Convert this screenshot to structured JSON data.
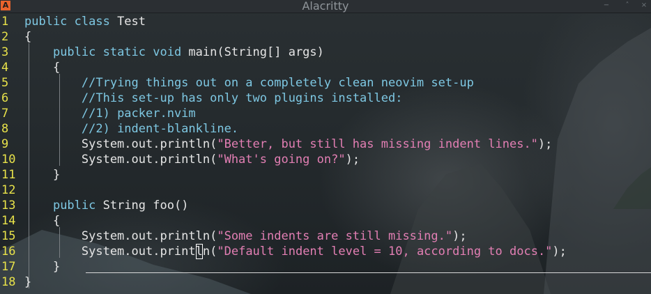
{
  "window": {
    "title": "Alacritty",
    "app_icon": "A",
    "controls": [
      "−",
      "˄",
      "×"
    ]
  },
  "colors": {
    "line_number": "#e8e24a",
    "keyword": "#7ec8e3",
    "comment": "#7ec8e3",
    "string": "#e37fb4",
    "text": "#e6e6e6"
  },
  "editor": {
    "lines": [
      {
        "n": "1",
        "parts": [
          [
            "kw",
            "public class "
          ],
          [
            "tx",
            "Test"
          ]
        ]
      },
      {
        "n": "2",
        "parts": [
          [
            "tx",
            "{"
          ]
        ]
      },
      {
        "n": "3",
        "parts": [
          [
            "tx",
            "    "
          ],
          [
            "kw",
            "public static void "
          ],
          [
            "tx",
            "main(String[] args)"
          ]
        ]
      },
      {
        "n": "4",
        "parts": [
          [
            "tx",
            "    {"
          ]
        ]
      },
      {
        "n": "5",
        "parts": [
          [
            "tx",
            "        "
          ],
          [
            "cm",
            "//Trying things out on a completely clean neovim set-up"
          ]
        ]
      },
      {
        "n": "6",
        "parts": [
          [
            "tx",
            "        "
          ],
          [
            "cm",
            "//This set-up has only two plugins installed:"
          ]
        ]
      },
      {
        "n": "7",
        "parts": [
          [
            "tx",
            "        "
          ],
          [
            "cm",
            "//1) packer.nvim"
          ]
        ]
      },
      {
        "n": "8",
        "parts": [
          [
            "tx",
            "        "
          ],
          [
            "cm",
            "//2) indent-blankline."
          ]
        ]
      },
      {
        "n": "9",
        "parts": [
          [
            "tx",
            "        System.out.println("
          ],
          [
            "st",
            "\"Better, but still has missing indent lines.\""
          ],
          [
            "tx",
            ");"
          ]
        ]
      },
      {
        "n": "10",
        "parts": [
          [
            "tx",
            "        System.out.println("
          ],
          [
            "st",
            "\"What's going on?\""
          ],
          [
            "tx",
            ");"
          ]
        ]
      },
      {
        "n": "11",
        "parts": [
          [
            "tx",
            "    }"
          ]
        ]
      },
      {
        "n": "12",
        "parts": []
      },
      {
        "n": "13",
        "parts": [
          [
            "tx",
            "    "
          ],
          [
            "kw",
            "public "
          ],
          [
            "tx",
            "String foo()"
          ]
        ]
      },
      {
        "n": "14",
        "parts": [
          [
            "tx",
            "    {"
          ]
        ]
      },
      {
        "n": "15",
        "parts": [
          [
            "tx",
            "        System.out.println("
          ],
          [
            "st",
            "\"Some indents are still missing.\""
          ],
          [
            "tx",
            ");"
          ]
        ]
      },
      {
        "n": "16",
        "parts": [
          [
            "tx",
            "        System.out.print"
          ],
          [
            "cur",
            "l"
          ],
          [
            "tx",
            "n("
          ],
          [
            "st",
            "\"Default indent level = 10, according to docs.\""
          ],
          [
            "tx",
            ");"
          ]
        ]
      },
      {
        "n": "17",
        "parts": [
          [
            "tx",
            "    }"
          ]
        ]
      },
      {
        "n": "18",
        "parts": [
          [
            "tx",
            "}"
          ]
        ]
      }
    ]
  }
}
